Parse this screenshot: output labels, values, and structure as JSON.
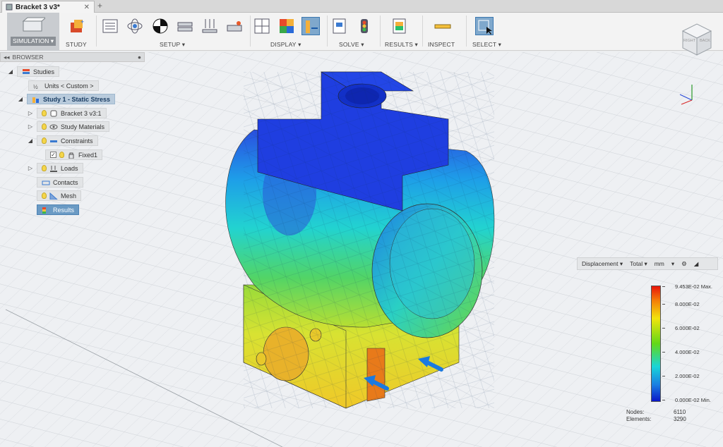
{
  "document": {
    "title": "Bracket 3 v3*"
  },
  "toolbar": {
    "workspace": "SIMULATION ▾",
    "groups": {
      "study": "STUDY",
      "setup": "SETUP ▾",
      "display": "DISPLAY ▾",
      "solve": "SOLVE ▾",
      "results": "RESULTS ▾",
      "inspect": "INSPECT",
      "select": "SELECT ▾"
    }
  },
  "browser": {
    "title": "BROWSER",
    "items": {
      "studies": "Studies",
      "units": "Units < Custom >",
      "study1": "Study 1 - Static Stress",
      "bracket": "Bracket 3 v3:1",
      "materials": "Study Materials",
      "constraints": "Constraints",
      "fixed": "Fixed1",
      "loads": "Loads",
      "contacts": "Contacts",
      "mesh": "Mesh",
      "results": "Results"
    }
  },
  "legend": {
    "result": "Displacement ▾",
    "component": "Total ▾",
    "units": "mm",
    "max": "9.453E-02 Max.",
    "t8": "8.000E-02",
    "t6": "6.000E-02",
    "t4": "4.000E-02",
    "t2": "2.000E-02",
    "min": "0.000E-02 Min."
  },
  "mesh_stats": {
    "nodes_label": "Nodes:",
    "nodes_value": "6110",
    "elements_label": "Elements:",
    "elements_value": "3290"
  },
  "viewcube": {
    "right": "RIGHT",
    "back": "BACK"
  },
  "colors": {
    "accent": "#3c78b0",
    "result_high": "#e8140a",
    "result_low": "#0a18c8"
  }
}
